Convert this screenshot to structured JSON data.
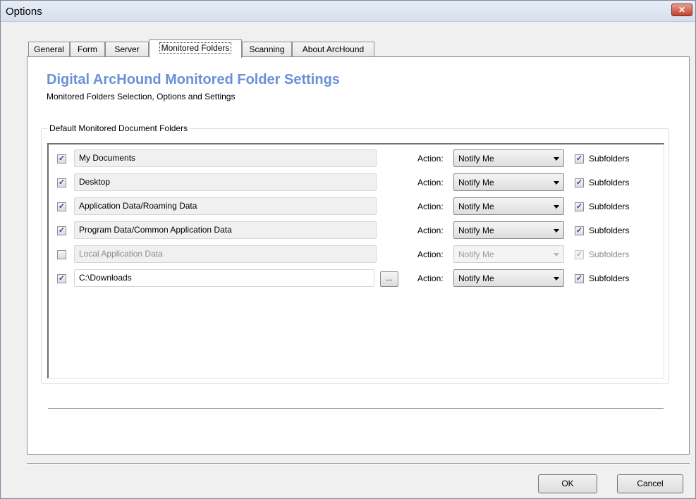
{
  "window": {
    "title": "Options",
    "close_symbol": "✕"
  },
  "tabs": [
    {
      "label": "General"
    },
    {
      "label": "Form"
    },
    {
      "label": "Server"
    },
    {
      "label": "Monitored Folders"
    },
    {
      "label": "Scanning"
    },
    {
      "label": "About ArcHound"
    }
  ],
  "active_tab": "Monitored Folders",
  "panel": {
    "heading": "Digital ArcHound Monitored Folder Settings",
    "subheading": "Monitored Folders Selection, Options and Settings",
    "group_title": "Default Monitored Document Folders"
  },
  "folders": [
    {
      "checked_mark": "✓",
      "path": "My Documents",
      "action_label": "Action:",
      "action": "Notify Me",
      "sub_mark": "✓",
      "sub_label": "Subfolders"
    },
    {
      "checked_mark": "✓",
      "path": "Desktop",
      "action_label": "Action:",
      "action": "Notify Me",
      "sub_mark": "✓",
      "sub_label": "Subfolders"
    },
    {
      "checked_mark": "✓",
      "path": "Application Data/Roaming Data",
      "action_label": "Action:",
      "action": "Notify Me",
      "sub_mark": "✓",
      "sub_label": "Subfolders"
    },
    {
      "checked_mark": "✓",
      "path": "Program Data/Common Application Data",
      "action_label": "Action:",
      "action": "Notify Me",
      "sub_mark": "✓",
      "sub_label": "Subfolders"
    },
    {
      "checked_mark": "",
      "path": "Local Application Data",
      "action_label": "Action:",
      "action": "Notify Me",
      "sub_mark": "✓",
      "sub_label": "Subfolders"
    },
    {
      "checked_mark": "✓",
      "path": "C:\\Downloads",
      "browse_label": "...",
      "action_label": "Action:",
      "action": "Notify Me",
      "sub_mark": "✓",
      "sub_label": "Subfolders"
    }
  ],
  "footer": {
    "ok_label": "OK",
    "cancel_label": "Cancel"
  }
}
